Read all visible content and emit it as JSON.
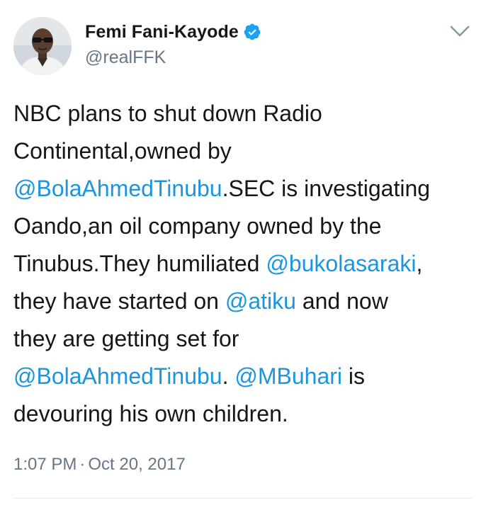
{
  "user": {
    "display_name": "Femi Fani-Kayode",
    "handle": "@realFFK",
    "verified": true,
    "avatar_icon": "profile-photo"
  },
  "tweet": {
    "line1": "NBC plans to shut down Radio",
    "line2": "Continental,owned by",
    "line3_mention": "@BolaAhmedTinubu",
    "line3_text": ".SEC is investigating",
    "line4": "Oando,an oil company owned by the",
    "line5_text": "Tinubus.They humiliated ",
    "line5_mention": "@bukolasaraki",
    "line5_end": ",",
    "line6_text": "they have started on ",
    "line6_mention": "@atiku",
    "line6_end": " and now",
    "line7": "they are getting set for",
    "line8_mention1": "@BolaAhmedTinubu",
    "line8_mid": ". ",
    "line8_mention2": "@MBuhari",
    "line8_end": " is",
    "line9": "devouring his own children."
  },
  "meta": {
    "time": "1:07 PM",
    "separator": "·",
    "date": "Oct 20, 2017"
  },
  "colors": {
    "mention": "#1b95e0",
    "verified": "#1da1f2",
    "secondary_text": "#657786"
  },
  "icons": {
    "verified": "verified-badge-icon",
    "menu": "chevron-down-icon"
  }
}
